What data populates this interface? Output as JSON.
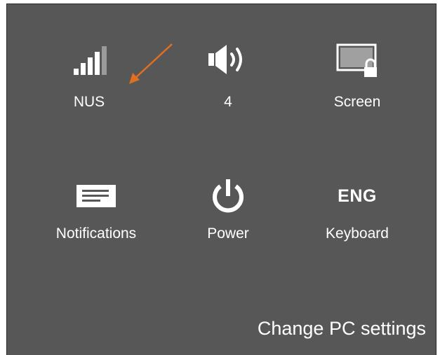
{
  "quick_settings": {
    "network_label": "NUS",
    "volume_label": "4",
    "screen_label": "Screen",
    "notifications_label": "Notifications",
    "power_label": "Power",
    "keyboard_label": "Keyboard",
    "keyboard_lang": "ENG"
  },
  "footer": {
    "change_settings_label": "Change PC settings"
  },
  "icons": {
    "network": "signal-bars-icon",
    "volume": "speaker-icon",
    "screen": "screen-lock-icon",
    "notifications": "message-icon",
    "power": "power-icon"
  },
  "colors": {
    "panel_bg": "#575757",
    "text": "#ffffff",
    "annotation_arrow": "#e07020"
  }
}
